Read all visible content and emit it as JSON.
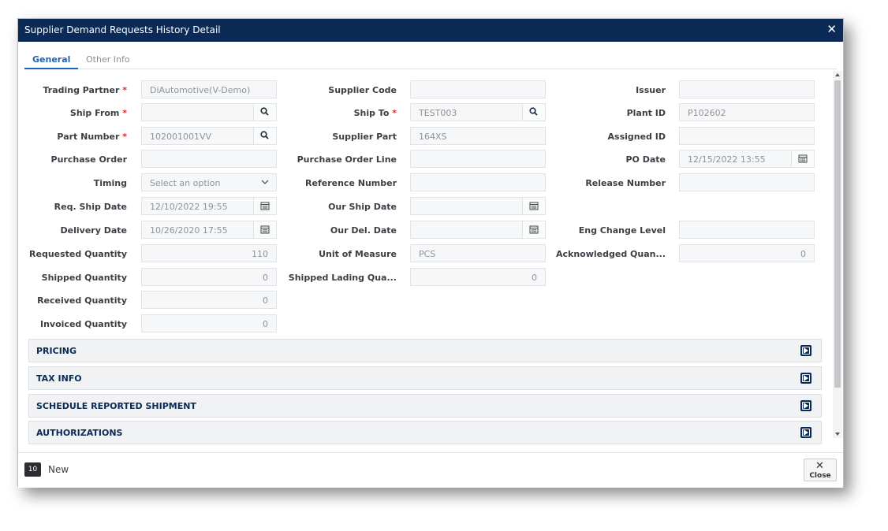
{
  "dialog": {
    "title": "Supplier Demand Requests History Detail"
  },
  "tabs": [
    {
      "label": "General",
      "active": true
    },
    {
      "label": "Other Info",
      "active": false
    }
  ],
  "fields": {
    "trading_partner": {
      "label": "Trading Partner",
      "value": "DiAutomotive(V-Demo)"
    },
    "ship_from": {
      "label": "Ship From",
      "value": ""
    },
    "part_number": {
      "label": "Part Number",
      "value": "102001001VV"
    },
    "purchase_order": {
      "label": "Purchase Order",
      "value": ""
    },
    "timing": {
      "label": "Timing",
      "value": "",
      "placeholder": "Select an option"
    },
    "req_ship_date": {
      "label": "Req. Ship Date",
      "value": "12/10/2022 19:55"
    },
    "delivery_date": {
      "label": "Delivery Date",
      "value": "10/26/2020 17:55"
    },
    "requested_quantity": {
      "label": "Requested Quantity",
      "value": "110"
    },
    "shipped_quantity": {
      "label": "Shipped Quantity",
      "value": "0"
    },
    "received_quantity": {
      "label": "Received Quantity",
      "value": "0"
    },
    "invoiced_quantity": {
      "label": "Invoiced Quantity",
      "value": "0"
    },
    "supplier_code": {
      "label": "Supplier Code",
      "value": ""
    },
    "ship_to": {
      "label": "Ship To",
      "value": "TEST003"
    },
    "supplier_part": {
      "label": "Supplier Part",
      "value": "164XS"
    },
    "purchase_order_line": {
      "label": "Purchase Order Line",
      "value": ""
    },
    "reference_number": {
      "label": "Reference Number",
      "value": ""
    },
    "our_ship_date": {
      "label": "Our Ship Date",
      "value": ""
    },
    "our_del_date": {
      "label": "Our Del. Date",
      "value": ""
    },
    "unit_of_measure": {
      "label": "Unit of Measure",
      "value": "PCS"
    },
    "shipped_lading_qty": {
      "label": "Shipped Lading Qua...",
      "value": "0"
    },
    "issuer": {
      "label": "Issuer",
      "value": ""
    },
    "plant_id": {
      "label": "Plant ID",
      "value": "P102602"
    },
    "assigned_id": {
      "label": "Assigned ID",
      "value": ""
    },
    "po_date": {
      "label": "PO Date",
      "value": "12/15/2022 13:55"
    },
    "release_number": {
      "label": "Release Number",
      "value": ""
    },
    "eng_change_level": {
      "label": "Eng Change Level",
      "value": ""
    },
    "acknowledged_qty": {
      "label": "Acknowledged Quan...",
      "value": "0"
    }
  },
  "sections": [
    {
      "title": "PRICING"
    },
    {
      "title": "TAX INFO"
    },
    {
      "title": "SCHEDULE REPORTED SHIPMENT"
    },
    {
      "title": "AUTHORIZATIONS"
    }
  ],
  "footer": {
    "badge": "10",
    "status": "New",
    "close_label": "Close"
  },
  "colors": {
    "header": "#0b2a55",
    "accent": "#1e63b5",
    "required": "#d12b2b"
  }
}
